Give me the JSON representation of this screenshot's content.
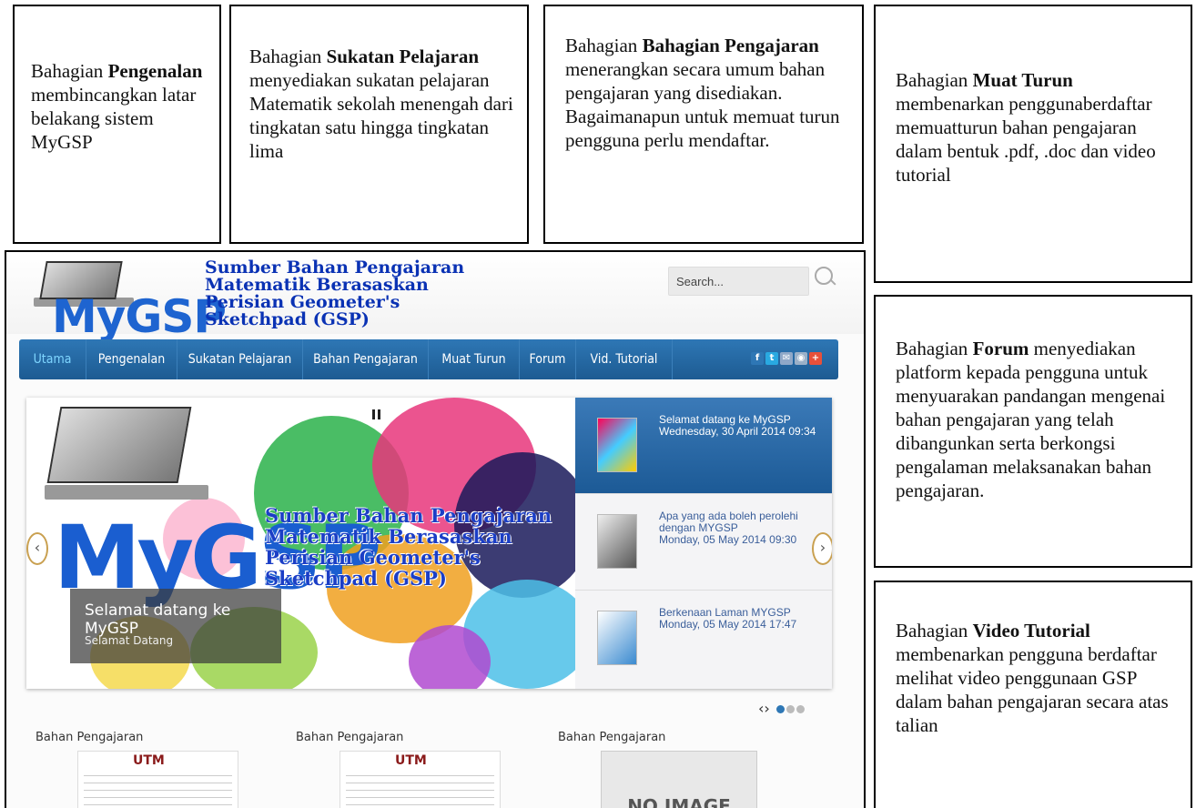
{
  "boxes": {
    "pengenalan": {
      "pre": "Bahagian ",
      "bold": "Pengenalan",
      "post": " membincangkan latar belakang sistem MyGSP"
    },
    "sukatan": {
      "pre": "Bahagian ",
      "bold": "Sukatan Pelajaran",
      "post": " menyediakan sukatan pelajaran Matematik sekolah menengah dari tingkatan satu hingga tingkatan lima"
    },
    "bahan": {
      "pre": "Bahagian ",
      "bold": "Bahagian Pengajaran",
      "post": " menerangkan secara umum bahan pengajaran yang disediakan. Bagaimanapun untuk memuat turun pengguna perlu mendaftar."
    },
    "muat_turun": {
      "pre": "Bahagian ",
      "bold": "Muat Turun",
      "post": " membenarkan penggunaberdaftar memuatturun bahan pengajaran dalam bentuk .pdf, .doc dan video tutorial"
    },
    "forum": {
      "pre": "Bahagian ",
      "bold": "Forum",
      "post": " menyediakan platform kepada pengguna untuk menyuarakan pandangan mengenai bahan  pengajaran yang telah dibangunkan serta berkongsi pengalaman melaksanakan bahan pengajaran."
    },
    "video": {
      "pre": "Bahagian ",
      "bold": "Video Tutorial",
      "post": " membenarkan pengguna berdaftar melihat video penggunaan GSP dalam bahan pengajaran secara atas talian"
    }
  },
  "site": {
    "logo": "MyGSP",
    "tagline": [
      "Sumber Bahan Pengajaran",
      "Matematik Berasaskan",
      "Perisian Geometer's",
      "Sketchpad (GSP)"
    ],
    "search_placeholder": "Search...",
    "nav": [
      "Utama",
      "Pengenalan",
      "Sukatan Pelajaran",
      "Bahan Pengajaran",
      "Muat Turun",
      "Forum",
      "Vid. Tutorial"
    ],
    "social_icons": [
      "facebook-icon",
      "twitter-icon",
      "email-icon",
      "rss-icon",
      "googleplus-icon"
    ],
    "slide": {
      "caption_title": "Selamat datang ke MyGSP",
      "caption_sub": "Selamat Datang"
    },
    "articles": [
      {
        "title": "Selamat datang ke MyGSP",
        "date": "Wednesday, 30 April 2014 09:34"
      },
      {
        "title": "Apa yang ada boleh perolehi dengan MYGSP",
        "date": "Monday, 05 May 2014 09:30"
      },
      {
        "title": "Berkenaan Laman MYGSP",
        "date": "Monday, 05 May 2014 17:47"
      }
    ],
    "sections": [
      "Bahan Pengajaran",
      "Bahan Pengajaran",
      "Bahan Pengajaran"
    ],
    "thumb_logo": "UTM",
    "no_image": "NO IMAGE"
  }
}
